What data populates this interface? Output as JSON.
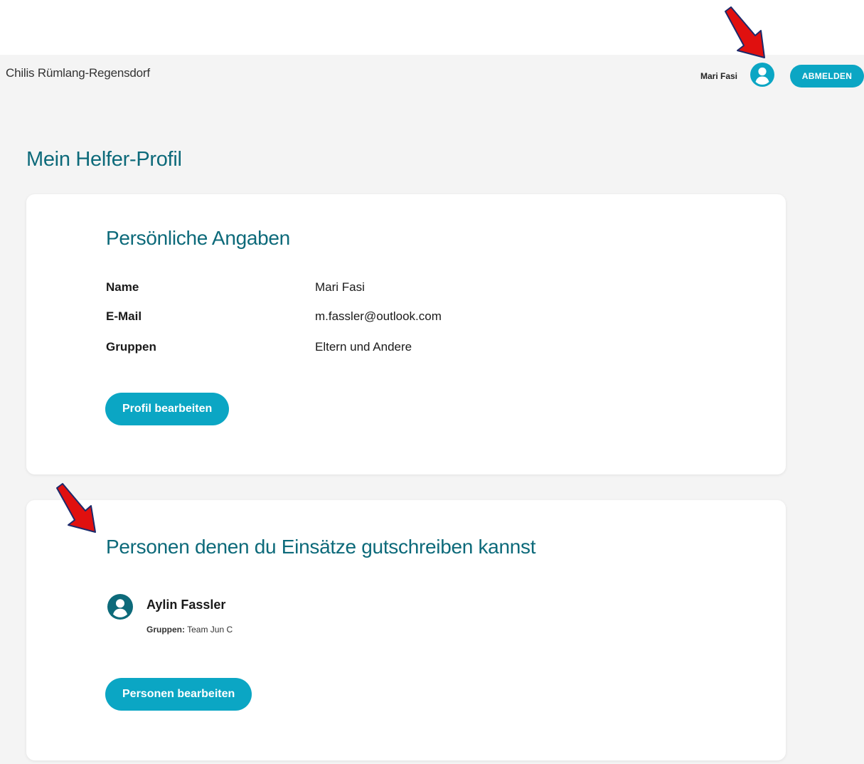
{
  "header": {
    "brand": "Chilis Rümlang-Regensdorf",
    "user_name": "Mari Fasi",
    "logout_label": "ABMELDEN"
  },
  "page": {
    "title": "Mein Helfer-Profil"
  },
  "personal": {
    "title": "Persönliche Angaben",
    "fields": [
      {
        "label": "Name",
        "value": "Mari Fasi"
      },
      {
        "label": "E-Mail",
        "value": "m.fassler@outlook.com"
      },
      {
        "label": "Gruppen",
        "value": "Eltern und Andere"
      }
    ],
    "edit_label": "Profil bearbeiten"
  },
  "persons": {
    "title": "Personen denen du Einsätze gutschreiben kannst",
    "list": [
      {
        "name": "Aylin Fassler",
        "groups_label": "Gruppen:",
        "groups_value": "Team Jun C"
      }
    ],
    "edit_label": "Personen bearbeiten"
  },
  "colors": {
    "accent": "#0ba6c4",
    "heading": "#0d6a7a",
    "app_background": "#f4f4f4",
    "annotation_arrow": "#e0100f"
  },
  "icons": {
    "header_avatar": "user-circle-icon",
    "person_avatar": "user-circle-icon",
    "annotations": "red-arrow-icon"
  }
}
